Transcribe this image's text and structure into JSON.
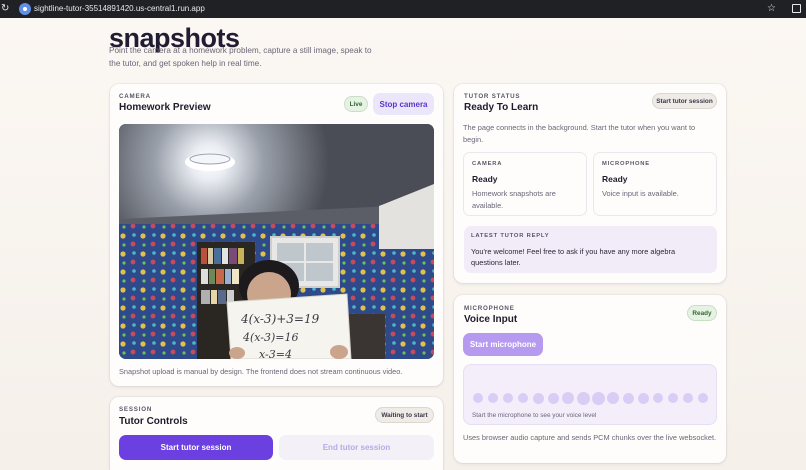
{
  "browser": {
    "url": "sightline-tutor-35514891420.us-central1.run.app"
  },
  "page": {
    "title": "snapshots",
    "intro": "Point the camera at a homework problem, capture a still image, speak to the tutor, and get spoken help in real time."
  },
  "camera": {
    "eyebrow": "CAMERA",
    "title": "Homework Preview",
    "badge": "Live",
    "stop_label": "Stop camera",
    "note": "Snapshot upload is manual by design. The frontend does not stream continuous video.",
    "board_lines": [
      "4(x-3)+3=19",
      "4(x-3)=16",
      "x-3=4"
    ]
  },
  "status": {
    "eyebrow": "TUTOR STATUS",
    "title": "Ready To Learn",
    "start_label": "Start tutor session",
    "description": "The page connects in the background. Start the tutor when you want to begin.",
    "camera": {
      "eyebrow": "CAMERA",
      "state": "Ready",
      "text": "Homework snapshots are available."
    },
    "microphone": {
      "eyebrow": "MICROPHONE",
      "state": "Ready",
      "text": "Voice input is available."
    },
    "reply": {
      "eyebrow": "LATEST TUTOR REPLY",
      "text": "You're welcome! Feel free to ask if you have any more algebra questions later."
    }
  },
  "voice": {
    "eyebrow": "MICROPHONE",
    "title": "Voice Input",
    "badge": "Ready",
    "start_label": "Start microphone",
    "hint": "Start the microphone to see your voice level",
    "note": "Uses browser audio capture and sends PCM chunks over the live websocket.",
    "level": 0
  },
  "controls": {
    "eyebrow": "SESSION",
    "title": "Tutor Controls",
    "badge": "Waiting to start",
    "start_label": "Start tutor session",
    "end_label": "End tutor session"
  },
  "colors": {
    "accent": "#6c3fe0",
    "accent_soft": "#ece6fb",
    "ready_green": "#2e6b2a",
    "background": "#f7f3ee"
  }
}
